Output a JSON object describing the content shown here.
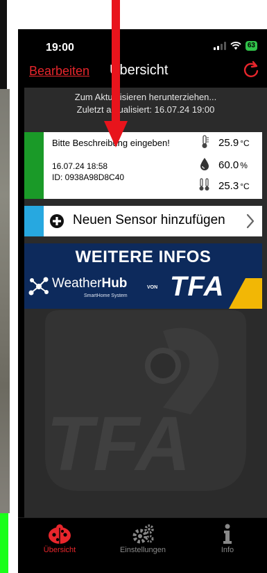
{
  "status": {
    "time": "19:00",
    "battery": "63"
  },
  "nav": {
    "edit_label": "Bearbeiten",
    "title": "Übersicht"
  },
  "refresh": {
    "pull_hint": "Zum Aktualisieren herunterziehen...",
    "last_updated": "Zuletzt aktualisiert: 16.07.24   19:00"
  },
  "sensor": {
    "description": "Bitte Beschreibung eingeben!",
    "date": "16.07.24   18:58",
    "id": "ID: 0938A98D8C40",
    "color": "#1a9a28",
    "readings": [
      {
        "icon": "thermometer-icon",
        "value": "25.9",
        "unit": "°C"
      },
      {
        "icon": "humidity-drop-icon",
        "value": "60.0",
        "unit": "%"
      },
      {
        "icon": "probe-thermometer-icon",
        "value": "25.3",
        "unit": "°C"
      }
    ]
  },
  "add_sensor": {
    "label": "Neuen Sensor hinzufügen",
    "color": "#27a8e0"
  },
  "banner": {
    "title": "WEITERE INFOS",
    "brand_light": "Weather",
    "brand_bold": "Hub",
    "subtitle": "SmartHome System",
    "von": "VON",
    "tfa": "TFA"
  },
  "tabs": [
    {
      "label": "Übersicht",
      "icon": "ladybug-icon",
      "active": true
    },
    {
      "label": "Einstellungen",
      "icon": "gears-icon",
      "active": false
    },
    {
      "label": "Info",
      "icon": "info-icon",
      "active": false
    }
  ],
  "colors": {
    "accent": "#e8262c",
    "arrow": "#e8141c",
    "banner_bg": "#0d2a5c",
    "tfa_yellow": "#f2b705"
  }
}
